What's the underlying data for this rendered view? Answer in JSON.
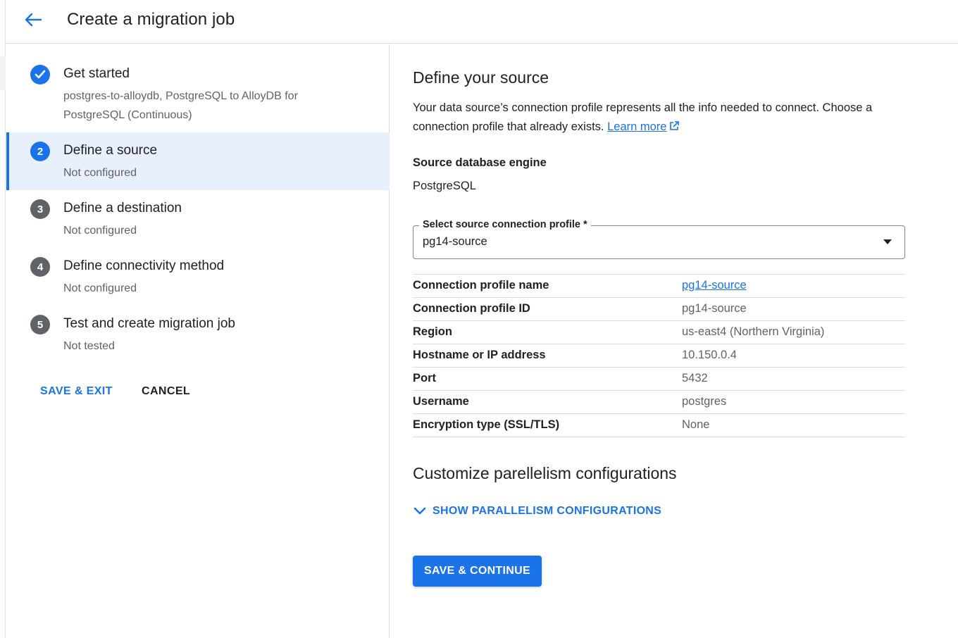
{
  "header": {
    "title": "Create a migration job",
    "back_icon": "arrow-back-icon"
  },
  "stepper": {
    "steps": [
      {
        "badge": "",
        "title": "Get started",
        "subtitle": "postgres-to-alloydb, PostgreSQL to AlloyDB for PostgreSQL (Continuous)",
        "state": "done"
      },
      {
        "badge": "2",
        "title": "Define a source",
        "subtitle": "Not configured",
        "state": "current"
      },
      {
        "badge": "3",
        "title": "Define a destination",
        "subtitle": "Not configured",
        "state": "todo"
      },
      {
        "badge": "4",
        "title": "Define connectivity method",
        "subtitle": "Not configured",
        "state": "todo"
      },
      {
        "badge": "5",
        "title": "Test and create migration job",
        "subtitle": "Not tested",
        "state": "todo"
      }
    ],
    "save_exit_label": "SAVE & EXIT",
    "cancel_label": "CANCEL"
  },
  "main": {
    "heading": "Define your source",
    "description": "Your data source’s connection profile represents all the info needed to connect. Choose a connection profile that already exists.",
    "learn_more": "Learn more",
    "engine_label": "Source database engine",
    "engine_value": "PostgreSQL",
    "select": {
      "label": "Select source connection profile *",
      "value": "pg14-source"
    },
    "details": [
      {
        "key": "Connection profile name",
        "value": "pg14-source",
        "link": true
      },
      {
        "key": "Connection profile ID",
        "value": "pg14-source",
        "link": false
      },
      {
        "key": "Region",
        "value": "us-east4 (Northern Virginia)",
        "link": false
      },
      {
        "key": "Hostname or IP address",
        "value": "10.150.0.4",
        "link": false
      },
      {
        "key": "Port",
        "value": "5432",
        "link": false
      },
      {
        "key": "Username",
        "value": "postgres",
        "link": false
      },
      {
        "key": "Encryption type (SSL/TLS)",
        "value": "None",
        "link": false
      }
    ],
    "parallel_heading": "Customize parellelism configurations",
    "parallel_toggle": "SHOW PARALLELISM CONFIGURATIONS",
    "primary_button": "SAVE & CONTINUE"
  },
  "colors": {
    "accent": "#1a73e8",
    "active_step_bg": "#e8f0fe",
    "pending_badge": "#5f6368"
  }
}
